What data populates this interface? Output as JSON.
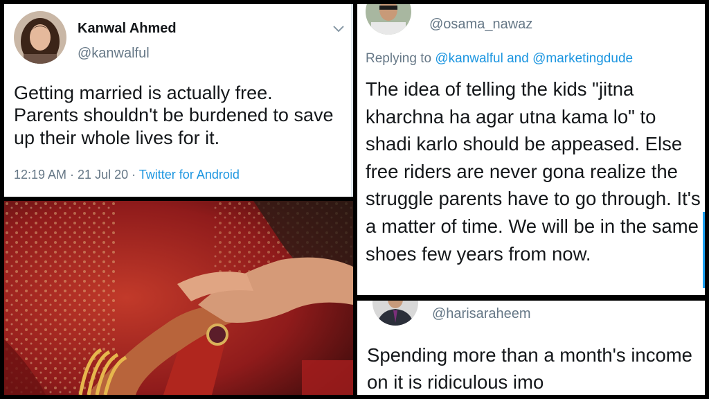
{
  "tweet1": {
    "name": "Kanwal Ahmed",
    "handle": "@kanwalful",
    "text": "Getting married is actually free. Parents shouldn't be burdened to save up their whole lives for it.",
    "time": "12:19 AM · 21 Jul 20",
    "source": "Twitter for Android",
    "menu_icon": "chevron-down-icon"
  },
  "tweet2": {
    "handle": "@osama_nawaz",
    "replying_prefix": "Replying to",
    "replying_users": "@kanwalful and @marketingdude",
    "text": "The idea of  telling the kids \"jitna kharchna ha agar utna kama lo\" to shadi karlo should be appeased. Else free riders are never gona realize the struggle parents have to go through. It's a matter of time. We will be in the same shoes few years from now."
  },
  "tweet3": {
    "handle": "@harisaraheem",
    "text": "Spending more than a month's income on it is ridiculous imo"
  },
  "colors": {
    "link": "#1b95e0",
    "text": "#14171a",
    "muted": "#657786"
  }
}
